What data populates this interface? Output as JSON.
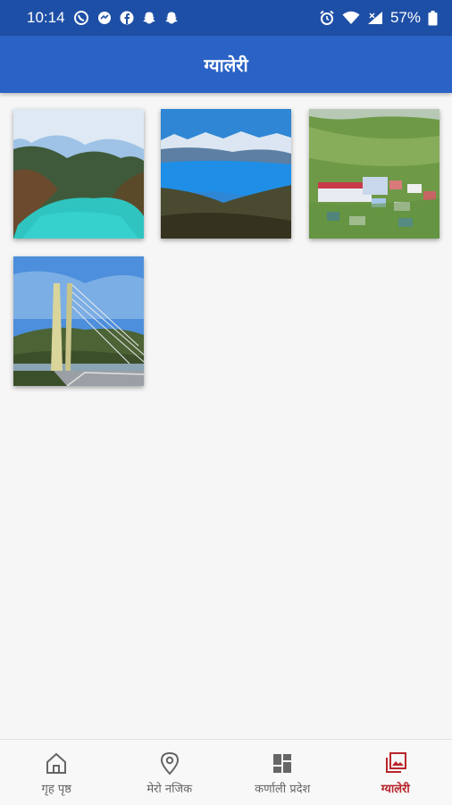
{
  "status_bar": {
    "time": "10:14",
    "battery": "57%"
  },
  "app_bar": {
    "title": "ग्यालेरी"
  },
  "gallery": [
    {
      "name": "gallery-image-turquoise-lake"
    },
    {
      "name": "gallery-image-blue-lake-mountains"
    },
    {
      "name": "gallery-image-hillside-town"
    },
    {
      "name": "gallery-image-suspension-bridge"
    }
  ],
  "bottom_nav": {
    "items": [
      {
        "label": "गृह पृष्ठ",
        "icon": "home-icon"
      },
      {
        "label": "मेरो नजिक",
        "icon": "location-pin-icon"
      },
      {
        "label": "कर्णाली प्रदेश",
        "icon": "dashboard-icon"
      },
      {
        "label": "ग्यालेरी",
        "icon": "gallery-icon"
      }
    ],
    "active_index": 3
  },
  "colors": {
    "status_bar": "#1e4fa6",
    "app_bar": "#2a62c5",
    "active_nav": "#b7252b",
    "inactive_nav": "#666666"
  }
}
